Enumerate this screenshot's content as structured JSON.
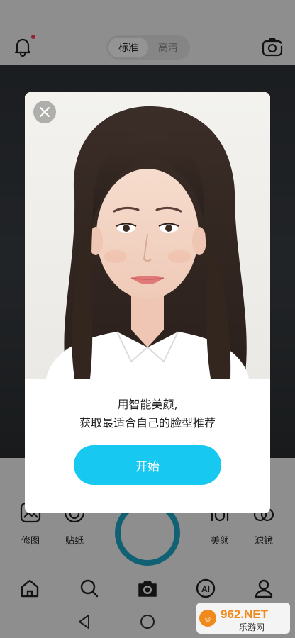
{
  "top_bar": {
    "quality_options": [
      "标准",
      "高清"
    ],
    "selected_quality": "标准",
    "icons": [
      "bell-icon",
      "switch-camera-icon"
    ]
  },
  "tools": {
    "retouch_label": "修图",
    "sticker_label": "贴纸",
    "beauty_label": "美颜",
    "filter_label": "滤镜"
  },
  "nav": {
    "icons": [
      "home-icon",
      "search-icon",
      "camera-icon",
      "ai-icon",
      "profile-icon"
    ]
  },
  "modal": {
    "line1": "用智能美颜,",
    "line2": "获取最适合自己的脸型推荐",
    "start_label": "开始"
  },
  "watermark": {
    "brand": "962.NET",
    "subtitle": "乐游网"
  },
  "colors": {
    "accent": "#17c8f0",
    "shutter_ring": "#1ea8c9",
    "notification_dot": "#ff3b5c"
  }
}
